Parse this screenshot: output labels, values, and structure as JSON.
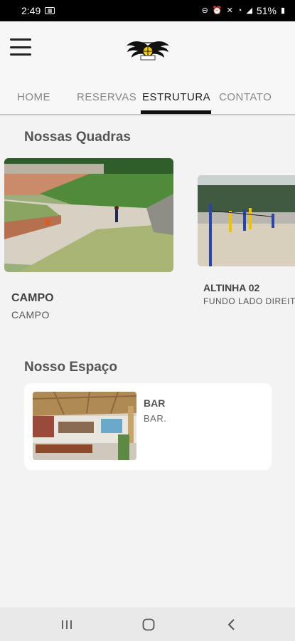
{
  "status": {
    "time": "2:49",
    "battery": "51%",
    "icons": [
      "image-icon",
      "link-icon",
      "alarm-icon",
      "mute-icon",
      "wifi-icon",
      "signal-icon",
      "battery-icon"
    ]
  },
  "header": {
    "menu_icon": "hamburger-menu-icon",
    "logo": "winged-ball-logo"
  },
  "tabs": [
    {
      "label": "HOME",
      "active": false
    },
    {
      "label": "RESERVAS",
      "active": false
    },
    {
      "label": "ESTRUTURA",
      "active": true
    },
    {
      "label": "CONTATO",
      "active": false
    }
  ],
  "courts": {
    "title": "Nossas Quadras",
    "items": [
      {
        "name": "CAMPO",
        "description": "CAMPO"
      },
      {
        "name": "ALTINHA 02",
        "description": "FUNDO LADO DIREITO."
      }
    ]
  },
  "spaces": {
    "title": "Nosso Espaço",
    "items": [
      {
        "name": "BAR",
        "description": "BAR."
      }
    ]
  },
  "nav": {
    "icons": [
      "recent-apps-icon",
      "home-icon",
      "back-icon"
    ]
  },
  "colors": {
    "background": "#f3f3f3",
    "active_tab_indicator": "#111111",
    "status_bar": "#000000"
  }
}
